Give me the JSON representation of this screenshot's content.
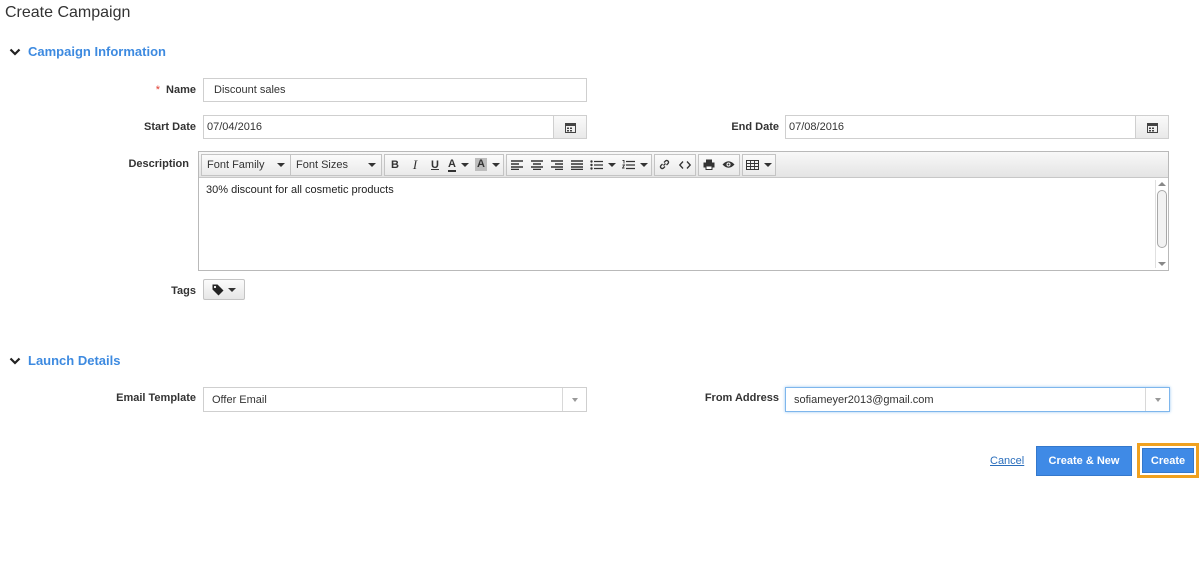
{
  "page": {
    "title": "Create Campaign"
  },
  "campaign_info": {
    "section_title": "Campaign Information",
    "name": {
      "label": "Name",
      "required_mark": "*",
      "value": "Discount sales"
    },
    "start_date": {
      "label": "Start Date",
      "value": "07/04/2016"
    },
    "end_date": {
      "label": "End Date",
      "value": "07/08/2016"
    },
    "description": {
      "label": "Description",
      "font_family_label": "Font Family",
      "font_sizes_label": "Font Sizes",
      "bold": "B",
      "italic": "I",
      "underline": "U",
      "text_color": "A",
      "bg_color": "A",
      "content": "30% discount  for all cosmetic products"
    },
    "tags": {
      "label": "Tags"
    }
  },
  "launch_details": {
    "section_title": "Launch Details",
    "email_template": {
      "label": "Email Template",
      "value": "Offer Email"
    },
    "from_address": {
      "label": "From Address",
      "value": "sofiameyer2013@gmail.com"
    }
  },
  "actions": {
    "cancel_label": "Cancel",
    "create_new_label": "Create & New",
    "create_label": "Create"
  },
  "colors": {
    "accent": "#3d8ae0",
    "button": "#3f8ae6",
    "highlight": "#f0a11f",
    "required": "#e03c31"
  }
}
